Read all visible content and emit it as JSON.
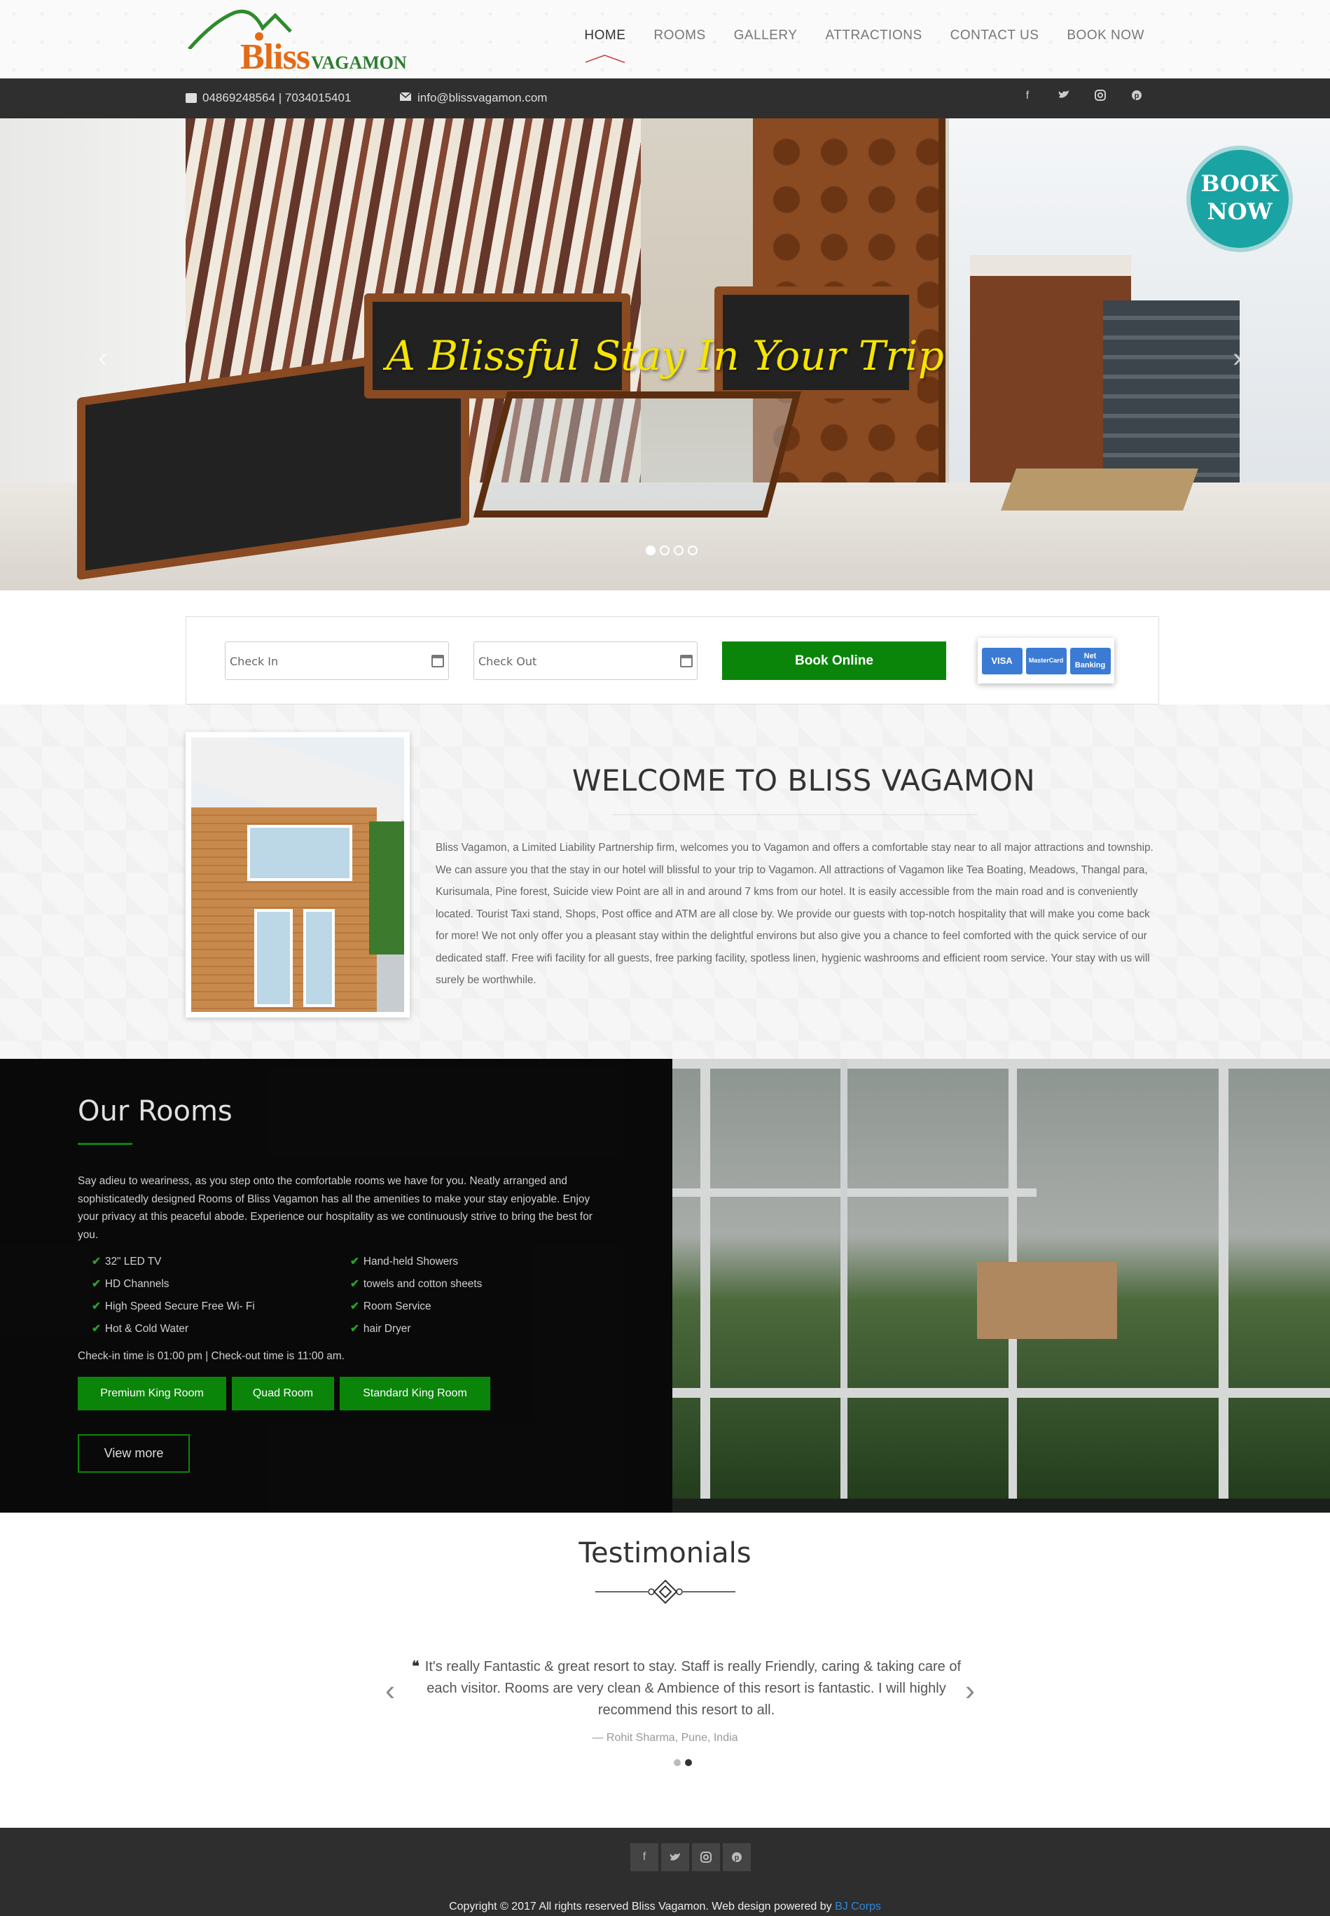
{
  "header": {
    "logo_brand": "Bliss",
    "logo_sub": "VAGAMON",
    "nav": [
      {
        "label": "HOME"
      },
      {
        "label": "ROOMS"
      },
      {
        "label": "GALLERY"
      },
      {
        "label": "ATTRACTIONS"
      },
      {
        "label": "CONTACT US"
      },
      {
        "label": "BOOK NOW"
      }
    ]
  },
  "topbar": {
    "phone": "04869248564 | 7034015401",
    "email": "info@blissvagamon.com",
    "socials": [
      "facebook-icon",
      "twitter-icon",
      "instagram-icon",
      "pinterest-icon"
    ]
  },
  "hero": {
    "title": "A Blissful Stay In Your Trip",
    "badge_line1": "BOOK",
    "badge_line2": "NOW",
    "slide_count": 4,
    "active_slide": 1
  },
  "booking": {
    "check_in_placeholder": "Check In",
    "check_out_placeholder": "Check Out",
    "button_label": "Book Online",
    "cards": [
      "VISA",
      "MasterCard",
      "Net Banking"
    ]
  },
  "welcome": {
    "title": "WELCOME TO BLISS VAGAMON",
    "body": "Bliss Vagamon, a Limited Liability Partnership firm, welcomes you to Vagamon and offers a comfortable stay near to all major attractions and township. We can assure you that the stay in our hotel will blissful to your trip to Vagamon. All attractions of Vagamon like Tea Boating, Meadows, Thangal para, Kurisumala, Pine forest, Suicide view Point are all in and around 7 kms from our hotel. It is easily accessible from the main road and is conveniently located. Tourist Taxi stand, Shops, Post office and ATM are all close by. We provide our guests with top-notch hospitality that will make you come back for more! We not only offer you a pleasant stay within the delightful environs but also give you a chance to feel comforted with the quick service of our dedicated staff. Free wifi facility for all guests, free parking facility, spotless linen, hygienic washrooms and efficient room service. Your stay with us will surely be worthwhile."
  },
  "rooms": {
    "title": "Our Rooms",
    "body": "Say adieu to weariness, as you step onto the comfortable rooms we have for you. Neatly arranged and sophisticatedly designed Rooms of Bliss Vagamon has all the amenities to make your stay enjoyable. Enjoy your privacy at this peaceful abode. Experience our hospitality as we continuously strive to bring the best for you.",
    "amenities_left": [
      "32\" LED TV",
      "HD Channels",
      "High Speed Secure Free Wi- Fi",
      "Hot & Cold Water"
    ],
    "amenities_right": [
      "Hand-held Showers",
      "towels and cotton sheets",
      "Room Service",
      "hair Dryer"
    ],
    "checkin": "Check-in time is 01:00 pm  |  Check-out time is 11:00 am.",
    "buttons": [
      "Premium King Room",
      "Quad Room",
      "Standard King Room"
    ],
    "view_more": "View more"
  },
  "testimonials": {
    "title": "Testimonials",
    "quote": "It's really Fantastic & great resort to stay. Staff is really Friendly, caring & taking care of each visitor. Rooms are very clean & Ambience of this resort is fantastic. I will highly recommend this resort to all.",
    "author": "— Rohit Sharma, Pune, India",
    "slide_count": 2,
    "active_slide": 2
  },
  "footer": {
    "socials": [
      "facebook-icon",
      "twitter-icon",
      "instagram-icon",
      "pinterest-icon"
    ],
    "copyright": "Copyright © 2017 All rights reserved Bliss Vagamon. Web design powered by",
    "credit": "BJ Corps"
  },
  "colors": {
    "accent_green": "#0a850a",
    "hero_title": "#f5e400",
    "badge_teal": "#1aa3a3",
    "nav_active_underline": "#d32f2f"
  }
}
